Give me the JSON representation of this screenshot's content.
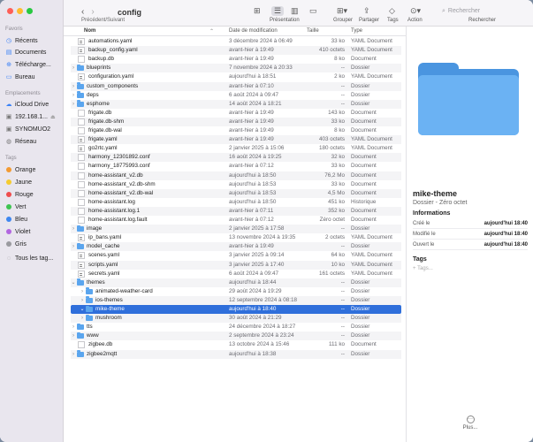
{
  "window": {
    "title": "config"
  },
  "toolbar": {
    "nav_label": "Précédent/Suivant",
    "presentation_label": "Présentation",
    "group_label": "Grouper",
    "share_label": "Partager",
    "tags_label": "Tags",
    "action_label": "Action",
    "search_label": "Rechercher",
    "search_placeholder": "Rechercher"
  },
  "sidebar": {
    "favorites_title": "Favoris",
    "favorites": [
      "Récents",
      "Documents",
      "Télécharge...",
      "Bureau"
    ],
    "locations_title": "Emplacements",
    "locations": [
      "iCloud Drive",
      "192.168.1...",
      "SYNOMUO2",
      "Réseau"
    ],
    "tags_title": "Tags",
    "tags": [
      {
        "label": "Orange",
        "color": "#f39a32"
      },
      {
        "label": "Jaune",
        "color": "#f5cb2f"
      },
      {
        "label": "Rouge",
        "color": "#ef4d4d"
      },
      {
        "label": "Vert",
        "color": "#3ec451"
      },
      {
        "label": "Bleu",
        "color": "#3f87f0"
      },
      {
        "label": "Violet",
        "color": "#b266e0"
      },
      {
        "label": "Gris",
        "color": "#9a9a9f"
      }
    ],
    "all_tags": "Tous les tag..."
  },
  "list": {
    "headers": {
      "name": "Nom",
      "date": "Date de modification",
      "size": "Taille",
      "kind": "Type"
    },
    "rows": [
      {
        "name": "automations.yaml",
        "date": "3 décembre 2024 à 06:49",
        "size": "33 ko",
        "kind": "YAML Document",
        "icon": "yaml",
        "level": 0
      },
      {
        "name": "backup_config.yaml",
        "date": "avant-hier à 19:49",
        "size": "410 octets",
        "kind": "YAML Document",
        "icon": "yaml",
        "level": 0
      },
      {
        "name": "backup.db",
        "date": "avant-hier à 19:49",
        "size": "8 ko",
        "kind": "Document",
        "icon": "file",
        "level": 0
      },
      {
        "name": "blueprints",
        "date": "7 novembre 2024 à 20:33",
        "size": "--",
        "kind": "Dossier",
        "icon": "folder",
        "level": 0,
        "chev": "›"
      },
      {
        "name": "configuration.yaml",
        "date": "aujourd'hui à 18:51",
        "size": "2 ko",
        "kind": "YAML Document",
        "icon": "yaml",
        "level": 0
      },
      {
        "name": "custom_components",
        "date": "avant-hier à 07:10",
        "size": "--",
        "kind": "Dossier",
        "icon": "folder",
        "level": 0,
        "chev": "›"
      },
      {
        "name": "deps",
        "date": "6 août 2024 à 09:47",
        "size": "--",
        "kind": "Dossier",
        "icon": "folder",
        "level": 0,
        "chev": "›"
      },
      {
        "name": "esphome",
        "date": "14 août 2024 à 18:21",
        "size": "--",
        "kind": "Dossier",
        "icon": "folder",
        "level": 0,
        "chev": "›"
      },
      {
        "name": "frigate.db",
        "date": "avant-hier à 19:49",
        "size": "143 ko",
        "kind": "Document",
        "icon": "file",
        "level": 0
      },
      {
        "name": "frigate.db-shm",
        "date": "avant-hier à 19:49",
        "size": "33 ko",
        "kind": "Document",
        "icon": "file",
        "level": 0
      },
      {
        "name": "frigate.db-wal",
        "date": "avant-hier à 19:49",
        "size": "8 ko",
        "kind": "Document",
        "icon": "file",
        "level": 0
      },
      {
        "name": "frigate.yaml",
        "date": "avant-hier à 19:49",
        "size": "403 octets",
        "kind": "YAML Document",
        "icon": "yaml",
        "level": 0
      },
      {
        "name": "go2rtc.yaml",
        "date": "2 janvier 2025 à 15:06",
        "size": "180 octets",
        "kind": "YAML Document",
        "icon": "yaml",
        "level": 0
      },
      {
        "name": "harmony_12301892.conf",
        "date": "16 août 2024 à 19:25",
        "size": "32 ko",
        "kind": "Document",
        "icon": "file",
        "level": 0
      },
      {
        "name": "harmony_18775993.conf",
        "date": "avant-hier à 07:12",
        "size": "33 ko",
        "kind": "Document",
        "icon": "file",
        "level": 0
      },
      {
        "name": "home-assistant_v2.db",
        "date": "aujourd'hui à 18:50",
        "size": "76,2 Mo",
        "kind": "Document",
        "icon": "file",
        "level": 0
      },
      {
        "name": "home-assistant_v2.db-shm",
        "date": "aujourd'hui à 18:53",
        "size": "33 ko",
        "kind": "Document",
        "icon": "file",
        "level": 0
      },
      {
        "name": "home-assistant_v2.db-wal",
        "date": "aujourd'hui à 18:53",
        "size": "4,5 Mo",
        "kind": "Document",
        "icon": "file",
        "level": 0
      },
      {
        "name": "home-assistant.log",
        "date": "aujourd'hui à 18:50",
        "size": "451 ko",
        "kind": "Historique",
        "icon": "file",
        "level": 0
      },
      {
        "name": "home-assistant.log.1",
        "date": "avant-hier à 07:11",
        "size": "352 ko",
        "kind": "Document",
        "icon": "file",
        "level": 0
      },
      {
        "name": "home-assistant.log.fault",
        "date": "avant-hier à 07:12",
        "size": "Zéro octet",
        "kind": "Document",
        "icon": "file",
        "level": 0
      },
      {
        "name": "image",
        "date": "2 janvier 2025 à 17:58",
        "size": "--",
        "kind": "Dossier",
        "icon": "folder",
        "level": 0,
        "chev": "›"
      },
      {
        "name": "ip_bans.yaml",
        "date": "13 novembre 2024 à 19:35",
        "size": "2 octets",
        "kind": "YAML Document",
        "icon": "yaml",
        "level": 0
      },
      {
        "name": "model_cache",
        "date": "avant-hier à 19:49",
        "size": "--",
        "kind": "Dossier",
        "icon": "folder",
        "level": 0,
        "chev": "›"
      },
      {
        "name": "scenes.yaml",
        "date": "3 janvier 2025 à 09:14",
        "size": "64 ko",
        "kind": "YAML Document",
        "icon": "yaml",
        "level": 0
      },
      {
        "name": "scripts.yaml",
        "date": "3 janvier 2025 à 17:40",
        "size": "10 ko",
        "kind": "YAML Document",
        "icon": "yaml",
        "level": 0
      },
      {
        "name": "secrets.yaml",
        "date": "6 août 2024 à 09:47",
        "size": "161 octets",
        "kind": "YAML Document",
        "icon": "yaml",
        "level": 0
      },
      {
        "name": "themes",
        "date": "aujourd'hui à 18:44",
        "size": "--",
        "kind": "Dossier",
        "icon": "folder",
        "level": 0,
        "chev": "⌄"
      },
      {
        "name": "animated-weather-card",
        "date": "29 août 2024 à 19:29",
        "size": "--",
        "kind": "Dossier",
        "icon": "folder",
        "level": 1,
        "chev": "›"
      },
      {
        "name": "ios-themes",
        "date": "12 septembre 2024 à 08:18",
        "size": "--",
        "kind": "Dossier",
        "icon": "folder",
        "level": 1,
        "chev": "›"
      },
      {
        "name": "mike-theme",
        "date": "aujourd'hui à 18:40",
        "size": "--",
        "kind": "Dossier",
        "icon": "folder",
        "level": 1,
        "chev": "⌄",
        "selected": true
      },
      {
        "name": "mushroom",
        "date": "30 août 2024 à 21:29",
        "size": "--",
        "kind": "Dossier",
        "icon": "folder",
        "level": 1,
        "chev": "›"
      },
      {
        "name": "tts",
        "date": "24 décembre 2024 à 18:27",
        "size": "--",
        "kind": "Dossier",
        "icon": "folder",
        "level": 0,
        "chev": "›"
      },
      {
        "name": "www",
        "date": "2 septembre 2024 à 23:24",
        "size": "--",
        "kind": "Dossier",
        "icon": "folder",
        "level": 0,
        "chev": "›"
      },
      {
        "name": "zigbee.db",
        "date": "13 octobre 2024 à 15:46",
        "size": "111 ko",
        "kind": "Document",
        "icon": "file",
        "level": 0
      },
      {
        "name": "zigbee2mqtt",
        "date": "aujourd'hui à 18:38",
        "size": "--",
        "kind": "Dossier",
        "icon": "folder",
        "level": 0,
        "chev": "›"
      }
    ]
  },
  "preview": {
    "name": "mike-theme",
    "subtitle": "Dossier - Zéro octet",
    "info_title": "Informations",
    "info": [
      {
        "key": "Créé le",
        "value": "aujourd'hui 18:40"
      },
      {
        "key": "Modifié le",
        "value": "aujourd'hui 18:40"
      },
      {
        "key": "Ouvert le",
        "value": "aujourd'hui 18:40"
      }
    ],
    "tags_title": "Tags",
    "tags_placeholder": "+ Tags...",
    "more_label": "Plus..."
  }
}
